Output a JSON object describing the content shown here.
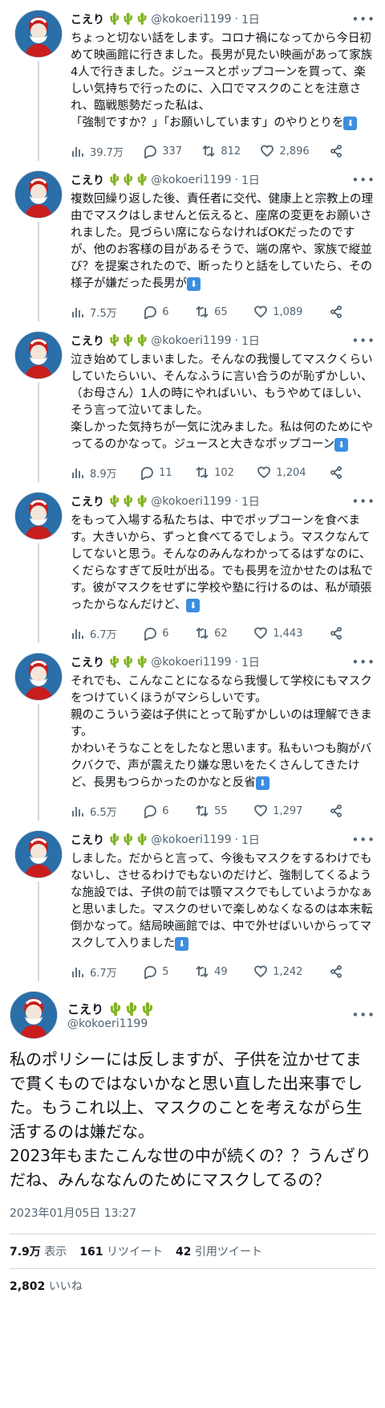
{
  "author": {
    "name": "こえり",
    "emoji": "🌵🌵🌵",
    "handle": "@kokoeri1199",
    "dot": "·",
    "time": "1日"
  },
  "tweets": [
    {
      "text": "ちょっと切ない話をします。コロナ禍になってから今日初めて映画館に行きました。長男が見たい映画があって家族4人で行きました。ジュースとポップコーンを買って、楽しい気持ちで行ったのに、入口でマスクのことを注意され、臨戦態勢だった私は、\n「強制ですか？」「お願いしています」のやりとりを",
      "views": "39.7万",
      "replies": "337",
      "retweets": "812",
      "likes": "2,896"
    },
    {
      "text": "複数回繰り返した後、責任者に交代、健康上と宗教上の理由でマスクはしませんと伝えると、座席の変更をお願いされました。見づらい席にならなければOKだったのですが、他のお客様の目があるそうで、端の席や、家族で縦並び？を提案されたので、断ったりと話をしていたら、その様子が嫌だった長男が",
      "views": "7.5万",
      "replies": "6",
      "retweets": "65",
      "likes": "1,089"
    },
    {
      "text": "泣き始めてしまいました。そんなの我慢してマスクくらいしていたらいい、そんなふうに言い合うのが恥ずかしい、（お母さん）1人の時にやればいい、もうやめてほしい、そう言って泣いてました。\n楽しかった気持ちが一気に沈みました。私は何のためにやってるのかなって。ジュースと大きなポップコーン",
      "views": "8.9万",
      "replies": "11",
      "retweets": "102",
      "likes": "1,204"
    },
    {
      "text": "をもって入場する私たちは、中でポップコーンを食べます。大きいから、ずっと食べてるでしょう。マスクなんてしてないと思う。そんなのみんなわかってるはずなのに、くだらなすぎて反吐が出る。でも長男を泣かせたのは私です。彼がマスクをせずに学校や塾に行けるのは、私が頑張ったからなんだけど、",
      "views": "6.7万",
      "replies": "6",
      "retweets": "62",
      "likes": "1,443"
    },
    {
      "text": "それでも、こんなことになるなら我慢して学校にもマスクをつけていくほうがマシらしいです。\n親のこういう姿は子供にとって恥ずかしいのは理解できます。\nかわいそうなことをしたなと思います。私もいつも胸がバクバクで、声が震えたり嫌な思いをたくさんしてきたけど、長男もつらかったのかなと反省",
      "views": "6.5万",
      "replies": "6",
      "retweets": "55",
      "likes": "1,297"
    },
    {
      "text": "しました。だからと言って、今後もマスクをするわけでもないし、させるわけでもないのだけど、強制してくるような施設では、子供の前では顎マスクでもしていようかなぁと思いました。マスクのせいで楽しめなくなるのは本末転倒かなって。結局映画館では、中で外せばいいからってマスクして入りました",
      "views": "6.7万",
      "replies": "5",
      "retweets": "49",
      "likes": "1,242"
    }
  ],
  "final": {
    "text": "私のポリシーには反しますが、子供を泣かせてまで貫くものではないかなと思い直した出来事でした。もうこれ以上、マスクのことを考えながら生活するのは嫌だな。\n2023年もまたこんな世の中が続くの？？うんざりだね、みんななんのためにマスクしてるの？",
    "date": "2023年01月05日 13:27",
    "views_value": "7.9万",
    "views_label": "表示",
    "retweets_value": "161",
    "retweets_label": "リツイート",
    "quotes_value": "42",
    "quotes_label": "引用ツイート",
    "likes_value": "2,802",
    "likes_label": "いいね"
  },
  "icons": [
    "views-icon",
    "reply-icon",
    "retweet-icon",
    "like-icon",
    "share-icon",
    "more-icon",
    "arrow-down-icon"
  ],
  "colors": {
    "link": "#1d9bf0",
    "muted": "#536471",
    "arrow_bg": "#3b8ee0",
    "cactus": "#58b82a"
  }
}
